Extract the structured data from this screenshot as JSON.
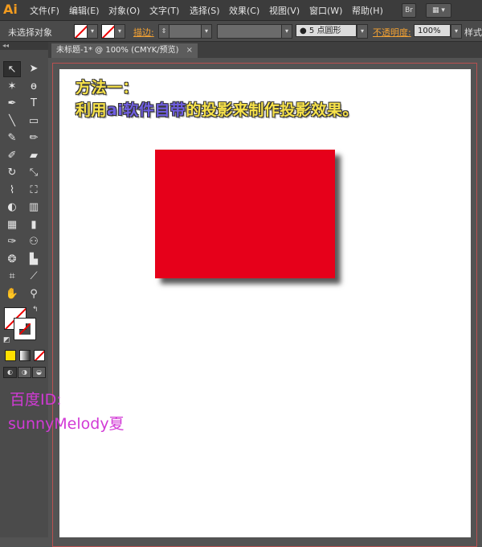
{
  "app": {
    "logo": "Ai"
  },
  "menu": [
    "文件(F)",
    "编辑(E)",
    "对象(O)",
    "文字(T)",
    "选择(S)",
    "效果(C)",
    "视图(V)",
    "窗口(W)",
    "帮助(H)"
  ],
  "menubar_buttons": {
    "bridge": "Br",
    "arrange": "▦ ▾"
  },
  "controlbar": {
    "selection_status": "未选择对象",
    "stroke_label": "描边:",
    "brush_value": "● 5 点圆形",
    "opacity_label": "不透明度:",
    "opacity_value": "100%",
    "style_label": "样式"
  },
  "tab": {
    "title": "未标题-1* @ 100% (CMYK/预览)",
    "close": "×"
  },
  "tools_header": "◂◂",
  "tools": [
    {
      "name": "selection-tool-icon",
      "glyph": "↖"
    },
    {
      "name": "direct-selection-tool-icon",
      "glyph": "➤"
    },
    {
      "name": "magic-wand-icon",
      "glyph": "✶"
    },
    {
      "name": "lasso-icon",
      "glyph": "ɵ"
    },
    {
      "name": "pen-tool-icon",
      "glyph": "✒"
    },
    {
      "name": "type-tool-icon",
      "glyph": "T"
    },
    {
      "name": "line-tool-icon",
      "glyph": "╲"
    },
    {
      "name": "rectangle-tool-icon",
      "glyph": "▭"
    },
    {
      "name": "paintbrush-icon",
      "glyph": "✎"
    },
    {
      "name": "pencil-icon",
      "glyph": "✏"
    },
    {
      "name": "blob-brush-icon",
      "glyph": "✐"
    },
    {
      "name": "eraser-icon",
      "glyph": "▰"
    },
    {
      "name": "rotate-tool-icon",
      "glyph": "↻"
    },
    {
      "name": "scale-tool-icon",
      "glyph": "⤡"
    },
    {
      "name": "warp-tool-icon",
      "glyph": "⌇"
    },
    {
      "name": "free-transform-icon",
      "glyph": "⛶"
    },
    {
      "name": "shape-builder-icon",
      "glyph": "◐"
    },
    {
      "name": "perspective-grid-icon",
      "glyph": "▥"
    },
    {
      "name": "mesh-tool-icon",
      "glyph": "▦"
    },
    {
      "name": "gradient-tool-icon",
      "glyph": "▮"
    },
    {
      "name": "eyedropper-icon",
      "glyph": "✑"
    },
    {
      "name": "blend-tool-icon",
      "glyph": "⚇"
    },
    {
      "name": "symbol-sprayer-icon",
      "glyph": "❂"
    },
    {
      "name": "column-graph-icon",
      "glyph": "▙"
    },
    {
      "name": "artboard-tool-icon",
      "glyph": "⌗"
    },
    {
      "name": "slice-tool-icon",
      "glyph": "⟋"
    },
    {
      "name": "hand-tool-icon",
      "glyph": "✋"
    },
    {
      "name": "zoom-tool-icon",
      "glyph": "⚲"
    }
  ],
  "canvas_text": {
    "line1": "方法一：",
    "line2_part1": "利用",
    "line2_part2": "ai",
    "line2_part3": "软件自带",
    "line2_part4": "的投影来制作投影效果。"
  },
  "watermark": {
    "line1": "百度ID:",
    "line2": "sunnyMelody夏"
  },
  "colors": {
    "rect_fill": "#e6001a",
    "note_text": "#f7e24a",
    "note_accent": "#6f5ee0",
    "watermark": "#d23ad6",
    "artboard_border": "#b85050"
  }
}
